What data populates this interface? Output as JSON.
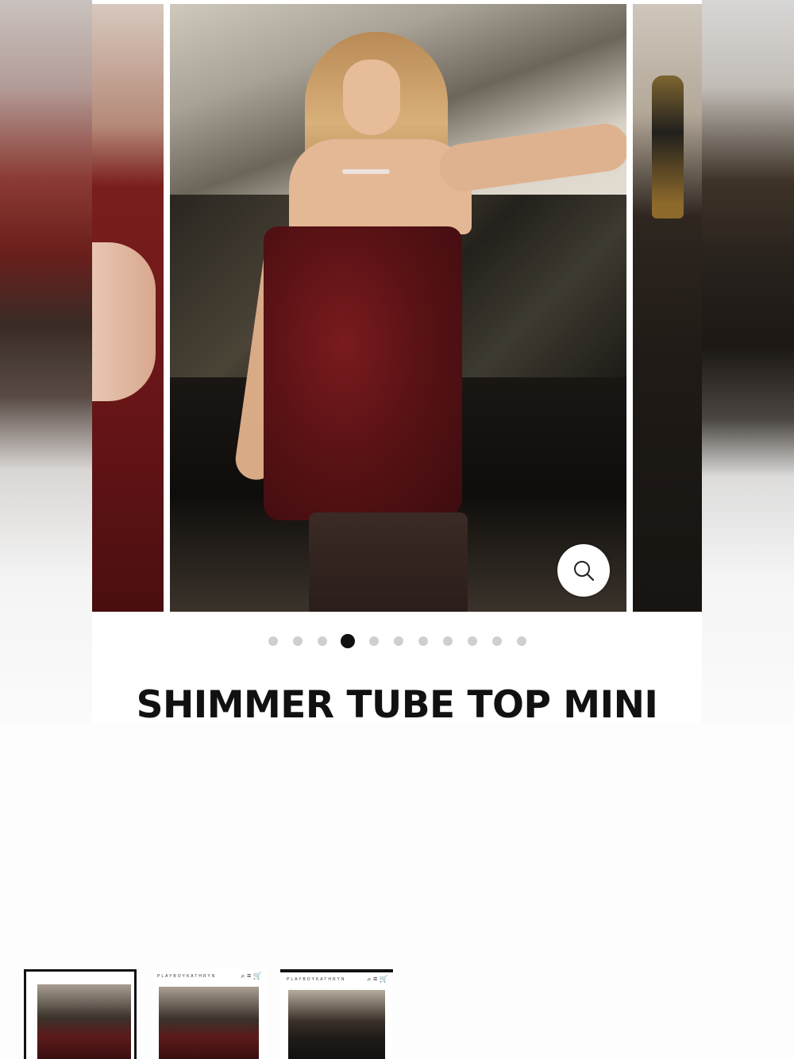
{
  "product": {
    "title": "SHIMMER TUBE TOP MINI"
  },
  "carousel": {
    "slide_count": 11,
    "active_index": 3
  },
  "thumbnails": [
    {
      "brand": "",
      "selected": true
    },
    {
      "brand": "PLAYBOYKATHRYN",
      "selected": false
    },
    {
      "brand": "PLAYBOYKATHRYN",
      "selected": false
    }
  ],
  "colors": {
    "dress": "#6b1619",
    "text": "#111111",
    "active_dot": "#111111",
    "inactive_dot": "#cfcfcf"
  },
  "icons": {
    "zoom": "magnifier-icon",
    "search": "search-icon",
    "menu": "menu-icon",
    "cart": "cart-icon"
  }
}
